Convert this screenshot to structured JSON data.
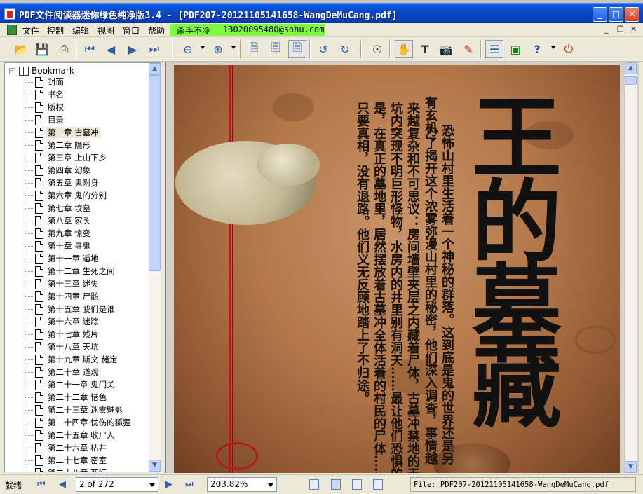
{
  "window": {
    "title": "PDF文件阅读器迷你绿色纯净版3.4 - [PDF207-20121105141658-WangDeMuCang.pdf]",
    "min_glyph": "_",
    "max_glyph": "□",
    "close_glyph": "✕"
  },
  "menu": {
    "items": [
      "文件",
      "控制",
      "编辑",
      "视图",
      "窗口",
      "帮助"
    ],
    "promo_text": "杀手不冷",
    "promo_email": "13020095480@sohu.com",
    "mdi_min": "_",
    "mdi_restore": "❐",
    "mdi_close": "✕"
  },
  "toolbar": {
    "icons": [
      "open-folder",
      "save-disk",
      "print",
      "first-page",
      "prev-page",
      "next-page",
      "last-page",
      "zoom-out",
      "zoom-in",
      "fit-page",
      "fit-width",
      "actual-size",
      "rotate-left",
      "rotate-right",
      "find-binoculars",
      "hand-tool",
      "text-select",
      "snapshot-camera",
      "highlight",
      "bookmark-panel",
      "thumbnail-panel",
      "help",
      "power"
    ]
  },
  "bookmarks": {
    "root": "Bookmark",
    "items": [
      "封面",
      "书名",
      "版权",
      "目录",
      "第一章 古墓冲",
      "第二章 隐形",
      "第三章 上山下乡",
      "第四章 幻象",
      "第五章 鬼附身",
      "第六章 鬼的分别",
      "第七章 坟墓",
      "第八章 家头",
      "第九章 惊变",
      "第十章 寻鬼",
      "第十一章 遁地",
      "第十二章 生死之间",
      "第十三章 迷失",
      "第十四章 尸骸",
      "第十五章 我们是谁",
      "第十六章 迷踪",
      "第十七章 残片",
      "第十八章 天坑",
      "第十九章 斯文 赭定",
      "第二十章 道观",
      "第二十一章 鬼门关",
      "第二十二章 惜色",
      "第二十三章 迷雾魅影",
      "第二十四章 忧伤的狐狸",
      "第二十五章 收尸人",
      "第二十六章 枯井",
      "第二十七章 密室",
      "第二十八章 西行"
    ],
    "selected_index": 4
  },
  "document": {
    "cover_title_chars": [
      "王",
      "的",
      "墓",
      "藏"
    ],
    "cover_columns": [
      "恐怖山村里生活着一个神秘的群落。这到底是鬼的世界还是另",
      "有玄机?",
      "为了揭开这个浓雾弥漫山村里的秘密，他们深入调查，事情越",
      "来越复杂和不可思议：房间墙壁夹层之内藏着尸体，古墓冲禁地的天",
      "坑内突现不明巨形怪物，水房内的井里别有洞天……最让他们恐惧的",
      "是，在真正的墓地里，居然摆放着古墓冲全体活着的村民的尸体……",
      "只要真相，没有退路。他们义无反顾地踏上了不归途。"
    ]
  },
  "status": {
    "ready": "就绪",
    "page_indicator": "2 of 272",
    "zoom": "203.82%",
    "file_label": "File: PDF207-20121105141658-WangDeMuCang.pdf"
  }
}
